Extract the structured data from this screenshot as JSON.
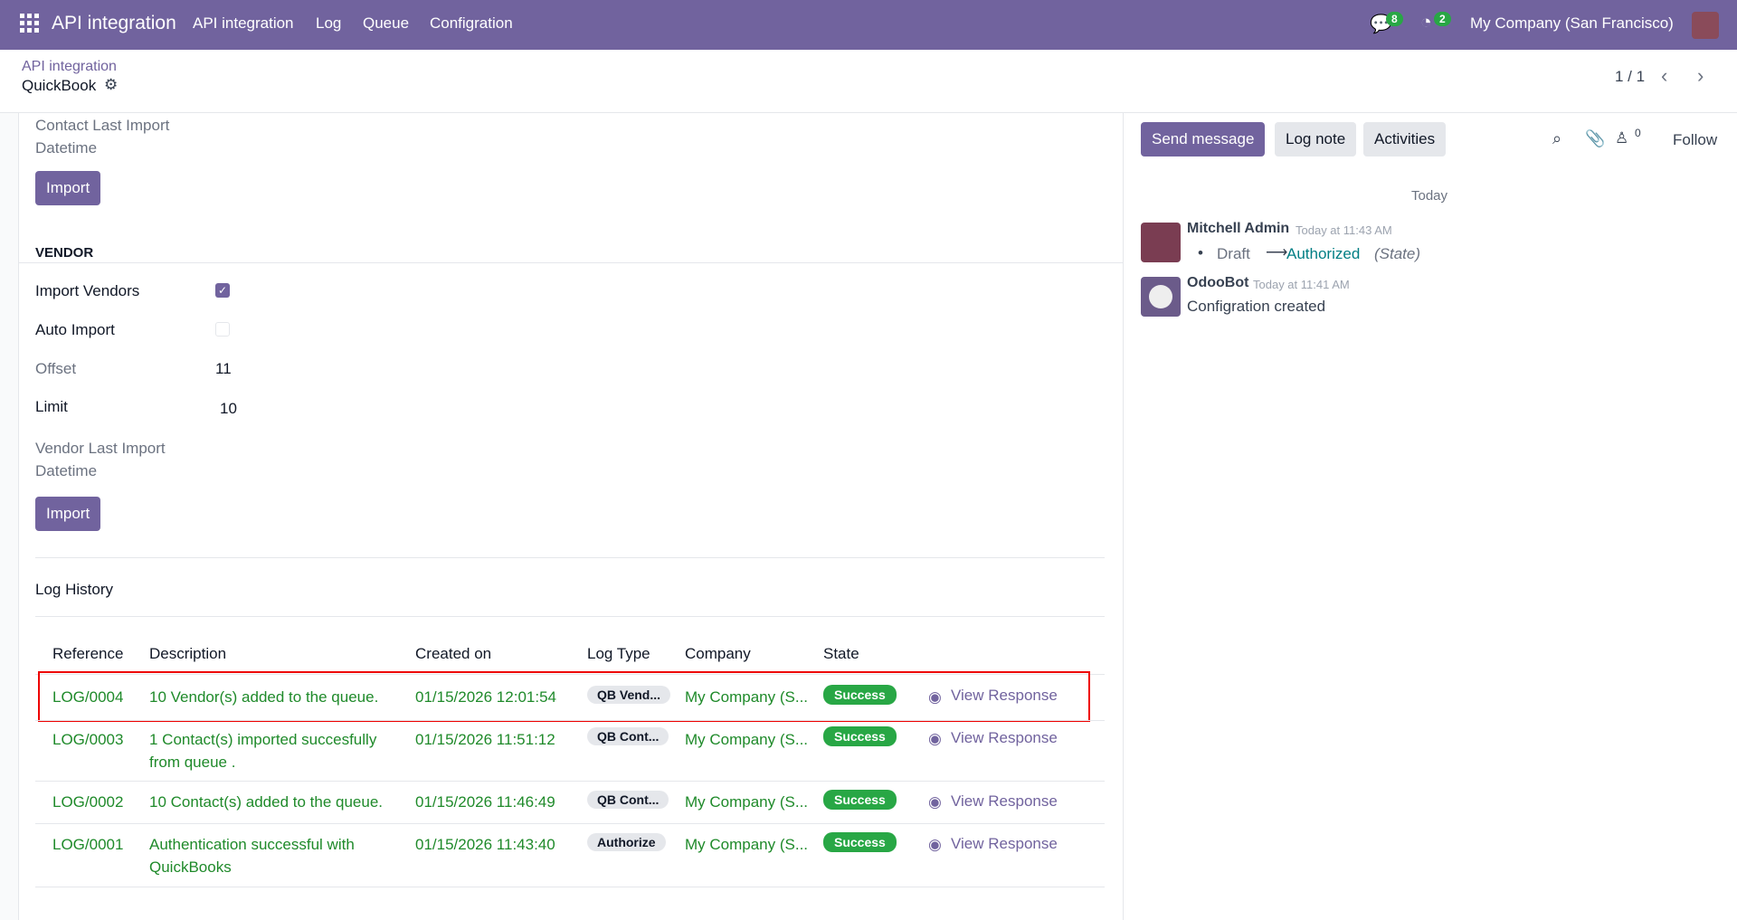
{
  "nav": {
    "app_title": "API integration",
    "menu": [
      "API integration",
      "Log",
      "Queue",
      "Configration"
    ],
    "messages_count": "8",
    "activities_count": "2",
    "company": "My Company (San Francisco)"
  },
  "breadcrumb": {
    "parent": "API integration",
    "current": "QuickBook"
  },
  "pager": {
    "value": "1 / 1"
  },
  "form": {
    "contact_last_import_label": "Contact Last Import Datetime",
    "import_label": "Import",
    "vendor_section": "VENDOR",
    "import_vendors_label": "Import Vendors",
    "import_vendors_checked": true,
    "auto_import_label": "Auto Import",
    "auto_import_checked": false,
    "offset_label": "Offset",
    "offset_value": "11",
    "limit_label": "Limit",
    "limit_value": "10",
    "vendor_last_import_label": "Vendor Last Import Datetime",
    "log_history_title": "Log History"
  },
  "log_table": {
    "headers": [
      "Reference",
      "Description",
      "Created on",
      "Log Type",
      "Company",
      "State"
    ],
    "rows": [
      {
        "ref": "LOG/0004",
        "desc": "10 Vendor(s) added to the queue.",
        "created": "01/15/2026 12:01:54",
        "type": "QB Vend...",
        "company": "My Company (S...",
        "state": "Success",
        "action": "View Response"
      },
      {
        "ref": "LOG/0003",
        "desc": "1 Contact(s) imported succesfully from queue .",
        "created": "01/15/2026 11:51:12",
        "type": "QB Cont...",
        "company": "My Company (S...",
        "state": "Success",
        "action": "View Response"
      },
      {
        "ref": "LOG/0002",
        "desc": "10 Contact(s) added to the queue.",
        "created": "01/15/2026 11:46:49",
        "type": "QB Cont...",
        "company": "My Company (S...",
        "state": "Success",
        "action": "View Response"
      },
      {
        "ref": "LOG/0001",
        "desc": "Authentication successful with QuickBooks",
        "created": "01/15/2026 11:43:40",
        "type": "Authorize",
        "company": "My Company (S...",
        "state": "Success",
        "action": "View Response"
      }
    ]
  },
  "chatter": {
    "send_message": "Send message",
    "log_note": "Log note",
    "activities": "Activities",
    "followers_count": "0",
    "follow": "Follow",
    "date_sep": "Today",
    "messages": [
      {
        "author": "Mitchell Admin",
        "time": "Today at 11:43 AM",
        "from": "Draft",
        "to": "Authorized",
        "field": "(State)"
      },
      {
        "author": "OdooBot",
        "time": "Today at 11:41 AM",
        "body": "Configration created"
      }
    ]
  }
}
